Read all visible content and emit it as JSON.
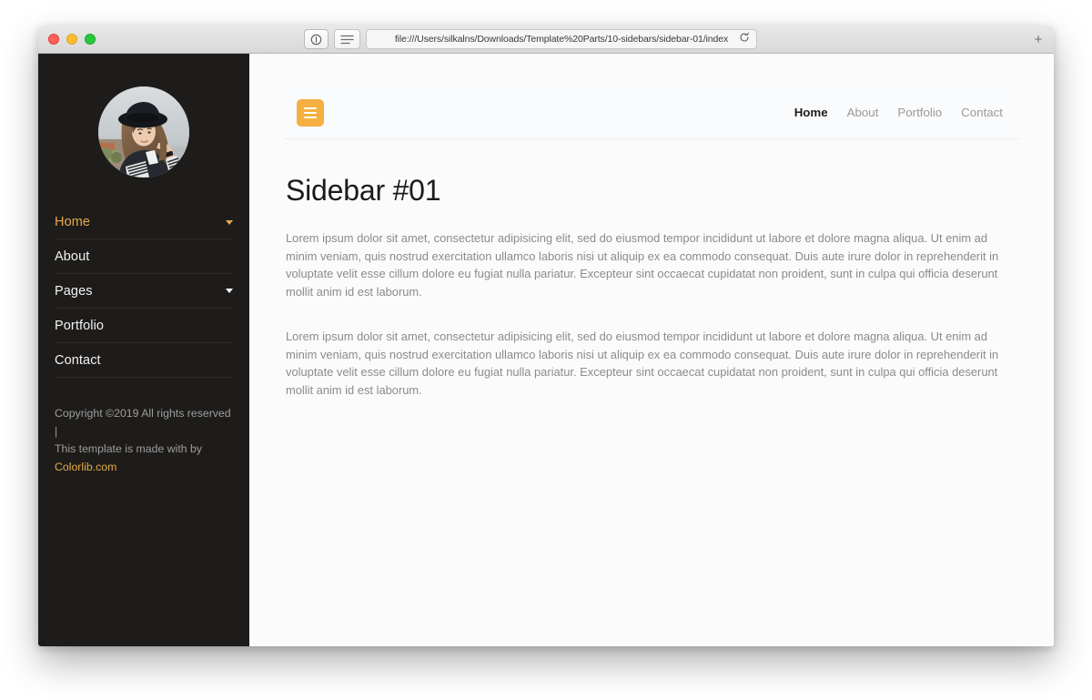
{
  "browser": {
    "url": "file:///Users/silkalns/Downloads/Template%20Parts/10-sidebars/sidebar-01/index",
    "reload_icon": "reload-icon",
    "sidebar_toggle_icon": "sidebar-toggle-icon",
    "shield_icon": "shield-icon",
    "new_tab_label": "+",
    "traffic_lights": {
      "close": "close-window-button",
      "minimize": "minimize-window-button",
      "maximize": "maximize-window-button"
    }
  },
  "sidebar": {
    "avatar_alt": "avatar",
    "items": [
      {
        "label": "Home",
        "active": true,
        "has_caret": true
      },
      {
        "label": "About",
        "active": false,
        "has_caret": false
      },
      {
        "label": "Pages",
        "active": false,
        "has_caret": true
      },
      {
        "label": "Portfolio",
        "active": false,
        "has_caret": false
      },
      {
        "label": "Contact",
        "active": false,
        "has_caret": false
      }
    ],
    "footer": {
      "line1": "Copyright ©2019 All rights reserved |",
      "line2": "This template is made with by",
      "link": "Colorlib.com"
    }
  },
  "topnav": {
    "menu_icon": "hamburger-menu-icon",
    "links": [
      {
        "label": "Home",
        "active": true
      },
      {
        "label": "About",
        "active": false
      },
      {
        "label": "Portfolio",
        "active": false
      },
      {
        "label": "Contact",
        "active": false
      }
    ]
  },
  "main": {
    "title": "Sidebar #01",
    "paragraphs": [
      "Lorem ipsum dolor sit amet, consectetur adipisicing elit, sed do eiusmod tempor incididunt ut labore et dolore magna aliqua. Ut enim ad minim veniam, quis nostrud exercitation ullamco laboris nisi ut aliquip ex ea commodo consequat. Duis aute irure dolor in reprehenderit in voluptate velit esse cillum dolore eu fugiat nulla pariatur. Excepteur sint occaecat cupidatat non proident, sunt in culpa qui officia deserunt mollit anim id est laborum.",
      "Lorem ipsum dolor sit amet, consectetur adipisicing elit, sed do eiusmod tempor incididunt ut labore et dolore magna aliqua. Ut enim ad minim veniam, quis nostrud exercitation ullamco laboris nisi ut aliquip ex ea commodo consequat. Duis aute irure dolor in reprehenderit in voluptate velit esse cillum dolore eu fugiat nulla pariatur. Excepteur sint occaecat cupidatat non proident, sunt in culpa qui officia deserunt mollit anim id est laborum."
    ]
  },
  "colors": {
    "accent_gold": "#e5ac49",
    "hamburger_orange": "#f5b041",
    "sidebar_bg": "#1e1c1a",
    "content_bg": "#fbfbfb",
    "body_text": "#8b8b8b"
  }
}
